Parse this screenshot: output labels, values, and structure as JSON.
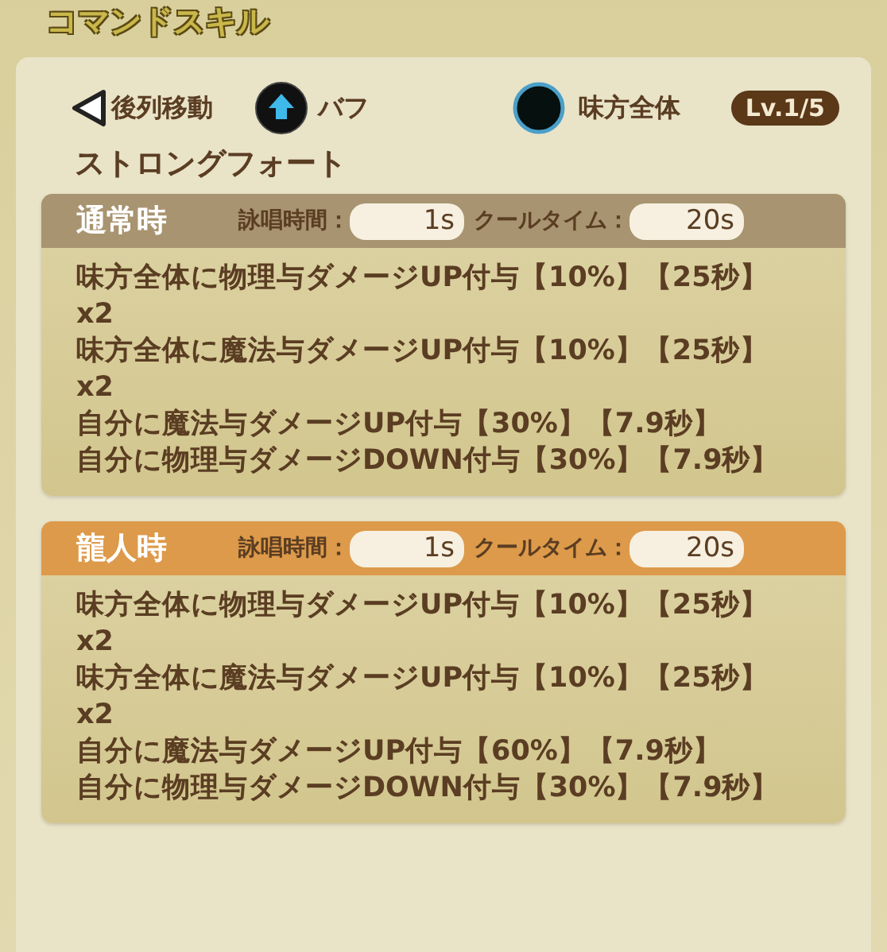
{
  "title": "コマンドスキル",
  "info": {
    "move": "後列移動",
    "type": "バフ",
    "target": "味方全体",
    "level": "Lv.1/5"
  },
  "skill_name": "ストロングフォート",
  "sections": [
    {
      "kind": "normal",
      "label": "通常時",
      "cast_label": "詠唱時間：",
      "cast": "1s",
      "cool_label": "クールタイム：",
      "cool": "20s",
      "effects": [
        "味方全体に物理与ダメージUP付与【10%】【25秒】x2",
        "味方全体に魔法与ダメージUP付与【10%】【25秒】x2",
        "自分に魔法与ダメージUP付与【30%】【7.9秒】",
        "自分に物理与ダメージDOWN付与【30%】【7.9秒】"
      ]
    },
    {
      "kind": "dragon",
      "label": "龍人時",
      "cast_label": "詠唱時間：",
      "cast": "1s",
      "cool_label": "クールタイム：",
      "cool": "20s",
      "effects": [
        "味方全体に物理与ダメージUP付与【10%】【25秒】x2",
        "味方全体に魔法与ダメージUP付与【10%】【25秒】x2",
        "自分に魔法与ダメージUP付与【60%】【7.9秒】",
        "自分に物理与ダメージDOWN付与【30%】【7.9秒】"
      ]
    }
  ]
}
